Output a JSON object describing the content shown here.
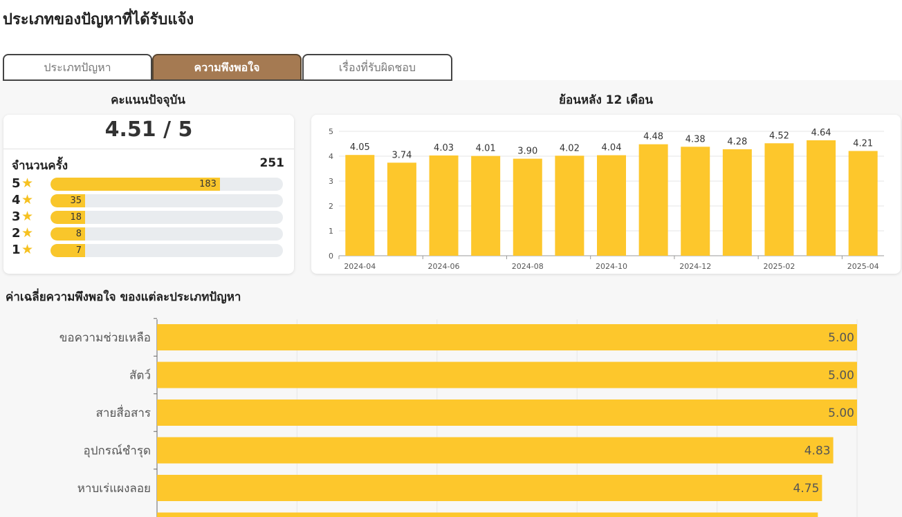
{
  "page": {
    "title": "ประเภทของปัญหาที่ได้รับแจ้ง"
  },
  "tabs": [
    {
      "label": "ประเภทปัญหา",
      "active": false
    },
    {
      "label": "ความพึงพอใจ",
      "active": true
    },
    {
      "label": "เรื่องที่รับผิดชอบ",
      "active": false
    }
  ],
  "colors": {
    "bar": "#fdc72c",
    "tab_active": "#a57a52",
    "star": "#f6c120",
    "track": "#e9ecef"
  },
  "current_score": {
    "title": "คะแนนปัจจุบัน",
    "score_text": "4.51 / 5",
    "count_label": "จำนวนครั้ง",
    "count_value": "251",
    "star_icon": "star-icon",
    "ratings": [
      {
        "star": "5",
        "count": 183
      },
      {
        "star": "4",
        "count": 35
      },
      {
        "star": "3",
        "count": 18
      },
      {
        "star": "2",
        "count": 8
      },
      {
        "star": "1",
        "count": 7
      }
    ]
  },
  "chart_data": [
    {
      "type": "bar",
      "title": "ย้อนหลัง 12 เดือน",
      "categories": [
        "2024-04",
        "2024-05",
        "2024-06",
        "2024-07",
        "2024-08",
        "2024-09",
        "2024-10",
        "2024-11",
        "2024-12",
        "2025-01",
        "2025-02",
        "2025-03",
        "2025-04"
      ],
      "values": [
        4.05,
        3.74,
        4.03,
        4.01,
        3.9,
        4.02,
        4.04,
        4.48,
        4.38,
        4.28,
        4.52,
        4.64,
        4.21
      ],
      "value_labels": [
        "4.05",
        "3.74",
        "4.03",
        "4.01",
        "3.90",
        "4.02",
        "4.04",
        "4.48",
        "4.38",
        "4.28",
        "4.52",
        "4.64",
        "4.21"
      ],
      "x_tick_labels": [
        "2024-04",
        "2024-06",
        "2024-08",
        "2024-10",
        "2024-12",
        "2025-02",
        "2025-04"
      ],
      "y_ticks": [
        "0",
        "1",
        "2",
        "3",
        "4",
        "5"
      ],
      "ylim": [
        0,
        5
      ],
      "grid": true
    },
    {
      "type": "bar",
      "orientation": "horizontal",
      "title": "ค่าเฉลี่ยความพึงพอใจ ของแต่ละประเภทปัญหา",
      "categories": [
        "ขอความช่วยเหลือ",
        "สัตว์",
        "สายสื่อสาร",
        "อุปกรณ์ชำรุด",
        "หาบเร่แผงลอย"
      ],
      "values": [
        5.0,
        5.0,
        5.0,
        4.83,
        4.75
      ],
      "value_labels": [
        "5.00",
        "5.00",
        "5.00",
        "4.83",
        "4.75"
      ],
      "xlim": [
        0,
        5
      ],
      "grid": true
    }
  ]
}
